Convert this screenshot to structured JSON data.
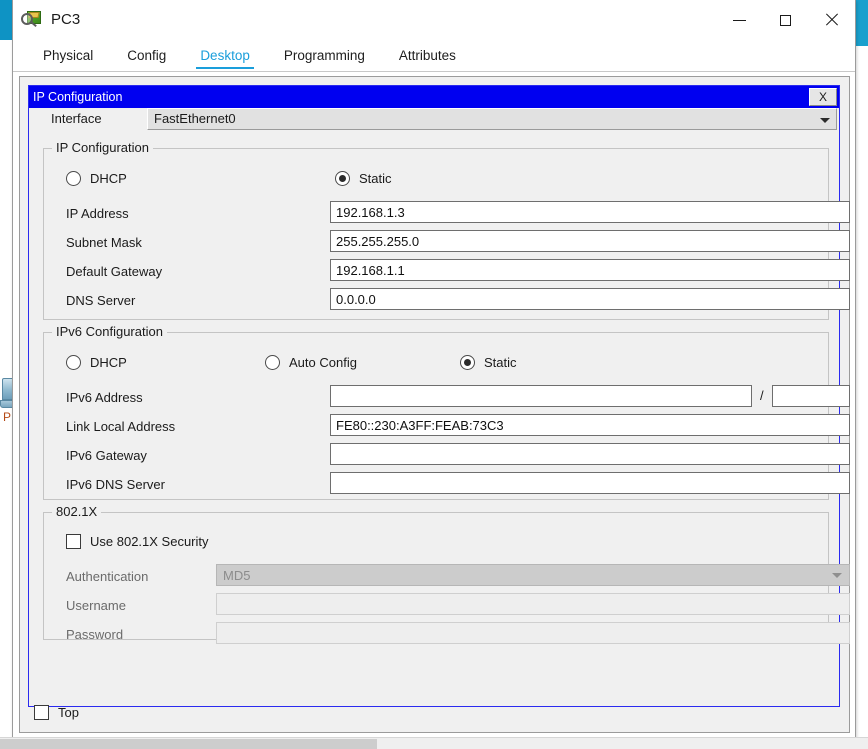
{
  "window": {
    "title": "PC3",
    "icon": "inspect-magnifier-icon",
    "minimize_label": "Minimize",
    "maximize_label": "Maximize",
    "close_label": "Close"
  },
  "tabs": [
    {
      "label": "Physical",
      "active": false
    },
    {
      "label": "Config",
      "active": false
    },
    {
      "label": "Desktop",
      "active": true
    },
    {
      "label": "Programming",
      "active": false
    },
    {
      "label": "Attributes",
      "active": false
    }
  ],
  "dialog": {
    "title": "IP Configuration",
    "close_label": "X",
    "interface": {
      "label": "Interface",
      "value": "FastEthernet0"
    },
    "ipv4": {
      "legend": "IP Configuration",
      "mode_dhcp_label": "DHCP",
      "mode_static_label": "Static",
      "mode_selected": "static",
      "fields": [
        {
          "label": "IP Address",
          "value": "192.168.1.3"
        },
        {
          "label": "Subnet Mask",
          "value": "255.255.255.0"
        },
        {
          "label": "Default Gateway",
          "value": "192.168.1.1"
        },
        {
          "label": "DNS Server",
          "value": "0.0.0.0"
        }
      ]
    },
    "ipv6": {
      "legend": "IPv6 Configuration",
      "mode_dhcp_label": "DHCP",
      "mode_autoconfig_label": "Auto Config",
      "mode_static_label": "Static",
      "mode_selected": "static",
      "address_label": "IPv6 Address",
      "address_value": "",
      "prefix_separator": "/",
      "prefix_value": "",
      "fields": [
        {
          "label": "Link Local Address",
          "value": "FE80::230:A3FF:FEAB:73C3"
        },
        {
          "label": "IPv6 Gateway",
          "value": ""
        },
        {
          "label": "IPv6 DNS Server",
          "value": ""
        }
      ]
    },
    "dot1x": {
      "legend": "802.1X",
      "use_security_label": "Use 802.1X Security",
      "use_security_checked": false,
      "authentication_label": "Authentication",
      "authentication_value": "MD5",
      "username_label": "Username",
      "username_value": "",
      "password_label": "Password",
      "password_value": ""
    }
  },
  "footer": {
    "top_label": "Top",
    "top_checked": false
  },
  "background": {
    "node_label": "P"
  },
  "colors": {
    "accent_tab": "#1a9edb",
    "dialog_titlebar": "#0000f0",
    "panel_bg": "#f0f0f0",
    "window_bg": "#ffffff"
  }
}
